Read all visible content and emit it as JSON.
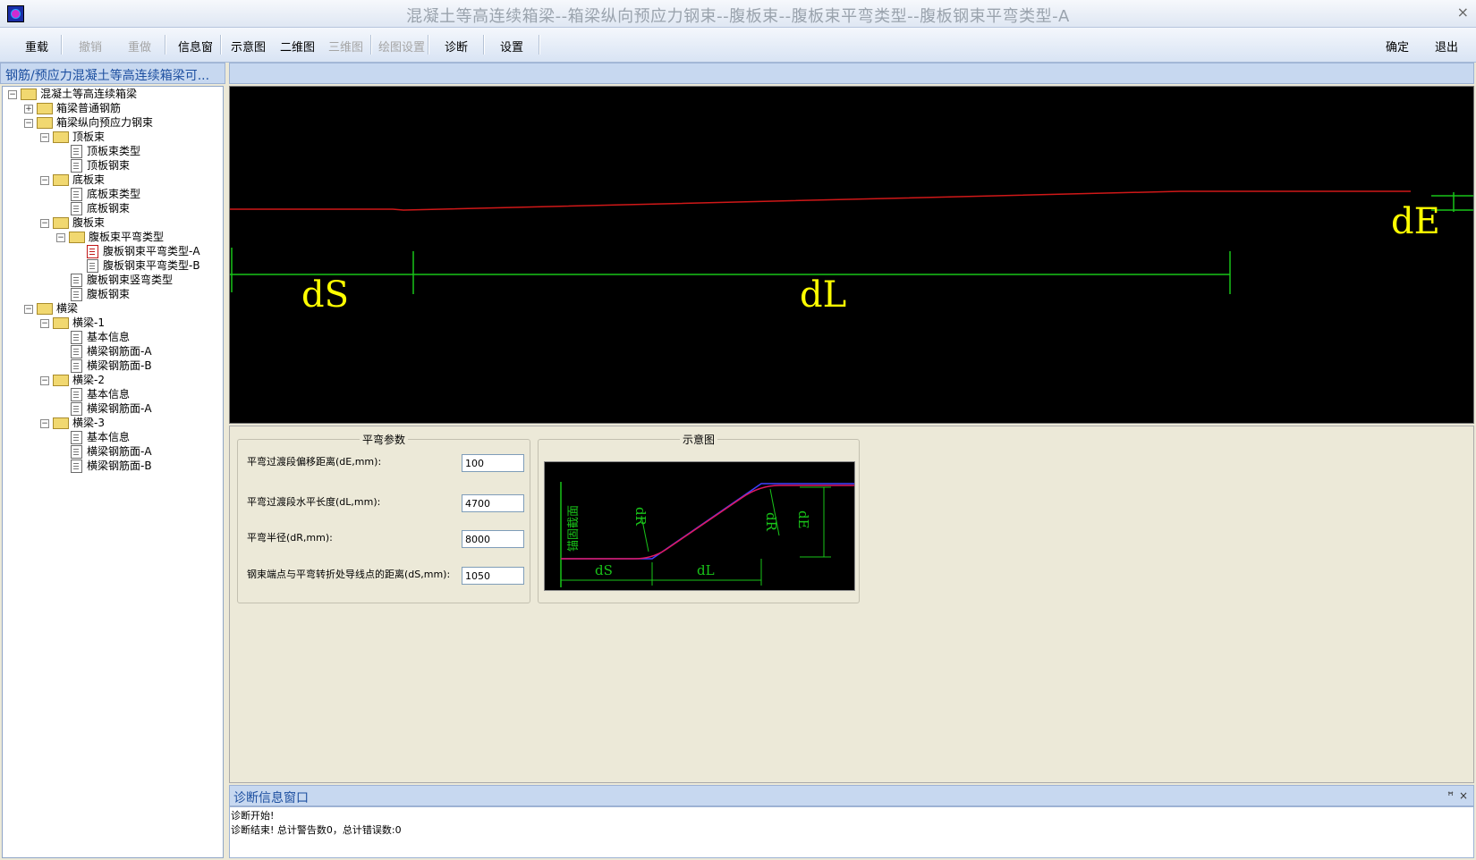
{
  "window": {
    "title": "混凝土等高连续箱梁--箱梁纵向预应力钢束--腹板束--腹板束平弯类型--腹板钢束平弯类型-A",
    "close_label": "×"
  },
  "toolbar": {
    "reload": "重载",
    "undo": "撤销",
    "redo": "重做",
    "info_window": "信息窗",
    "schematic": "示意图",
    "view_2d": "二维图",
    "view_3d": "三维图",
    "draw_settings": "绘图设置",
    "diagnose": "诊断",
    "settings": "设置",
    "ok": "确定",
    "exit": "退出"
  },
  "left_panel": {
    "header": "钢筋/预应力混凝土等高连续箱梁可..."
  },
  "tree": {
    "root": "混凝土等高连续箱梁",
    "ordinary_rebar": "箱梁普通钢筋",
    "longitudinal_tendon": "箱梁纵向预应力钢束",
    "top_slab": "顶板束",
    "top_slab_type": "顶板束类型",
    "top_slab_tendon": "顶板钢束",
    "bottom_slab": "底板束",
    "bottom_slab_type": "底板束类型",
    "bottom_slab_tendon": "底板钢束",
    "web": "腹板束",
    "web_h_bend_type": "腹板束平弯类型",
    "web_h_bend_a": "腹板钢束平弯类型-A",
    "web_h_bend_b": "腹板钢束平弯类型-B",
    "web_v_bend_type": "腹板钢束竖弯类型",
    "web_tendon": "腹板钢束",
    "crossbeams": "横梁",
    "cb1": "横梁-1",
    "cb1_info": "基本信息",
    "cb1_a": "横梁钢筋面-A",
    "cb1_b": "横梁钢筋面-B",
    "cb2": "横梁-2",
    "cb2_info": "基本信息",
    "cb2_a": "横梁钢筋面-A",
    "cb3": "横梁-3",
    "cb3_info": "基本信息",
    "cb3_a": "横梁钢筋面-A",
    "cb3_b": "横梁钢筋面-B"
  },
  "canvas": {
    "label_ds": "dS",
    "label_dl": "dL",
    "label_de": "dE",
    "colors": {
      "tendon": "#d01818",
      "dimension": "#19c419",
      "label": "#ffff00"
    }
  },
  "params": {
    "group_title": "平弯参数",
    "de_label": "平弯过渡段偏移距离(dE,mm):",
    "de_value": "100",
    "dl_label": "平弯过渡段水平长度(dL,mm):",
    "dl_value": "4700",
    "dr_label": "平弯半径(dR,mm):",
    "dr_value": "8000",
    "ds_label": "钢束端点与平弯转折处导线点的距离(dS,mm):",
    "ds_value": "1050"
  },
  "sketch": {
    "group_title": "示意图",
    "vertical_label": "锚固截面",
    "dr1": "dR",
    "dr2": "dR",
    "de": "dE",
    "ds": "dS",
    "dl": "dL"
  },
  "diagnostics": {
    "title": "诊断信息窗口",
    "pin_label": "ꟸ",
    "close_label": "×",
    "lines": [
      "诊断开始!",
      "诊断结束! 总计警告数0，总计错误数:0"
    ]
  }
}
